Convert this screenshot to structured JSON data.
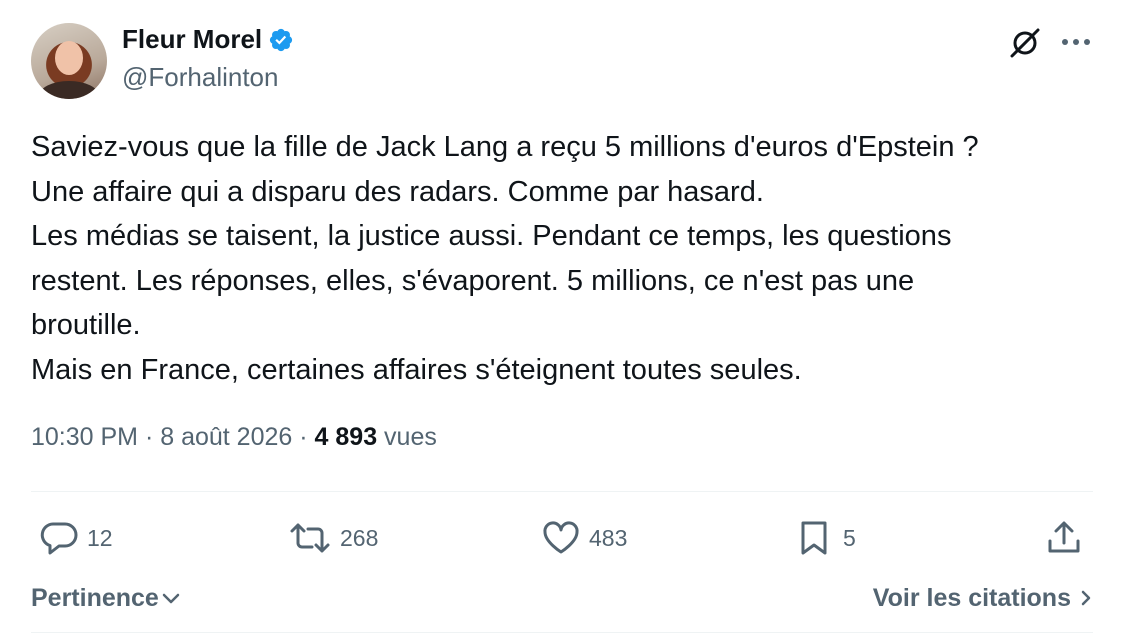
{
  "author": {
    "name": "Fleur Morel",
    "handle": "@Forhalinton",
    "verified": true,
    "verified_color": "#1d9bf0"
  },
  "header_icons": [
    "grok-icon",
    "more-options-icon"
  ],
  "tweet": {
    "lines": [
      "Saviez-vous que la fille de Jack Lang a reçu 5 millions d'euros d'Epstein ?",
      "Une affaire qui a disparu des radars. Comme par hasard.",
      "Les médias se taisent, la justice aussi. Pendant ce temps, les questions",
      "restent. Les réponses, elles, s'évaporent. 5 millions, ce n'est pas une",
      "broutille.",
      "Mais en France, certaines affaires s'éteignent toutes seules."
    ]
  },
  "meta": {
    "time": "10:30 PM",
    "separator": " · ",
    "date": "8 août 2026",
    "views_count": "4 893",
    "views_label": "vues"
  },
  "actions": {
    "replies": "12",
    "reposts": "268",
    "likes": "483",
    "bookmarks": "5"
  },
  "footer": {
    "sort_label": "Pertinence",
    "quotes_label": "Voir les citations"
  },
  "colors": {
    "text": "#0f1419",
    "secondary": "#536471",
    "divider": "#eff3f4",
    "accent": "#1d9bf0"
  }
}
